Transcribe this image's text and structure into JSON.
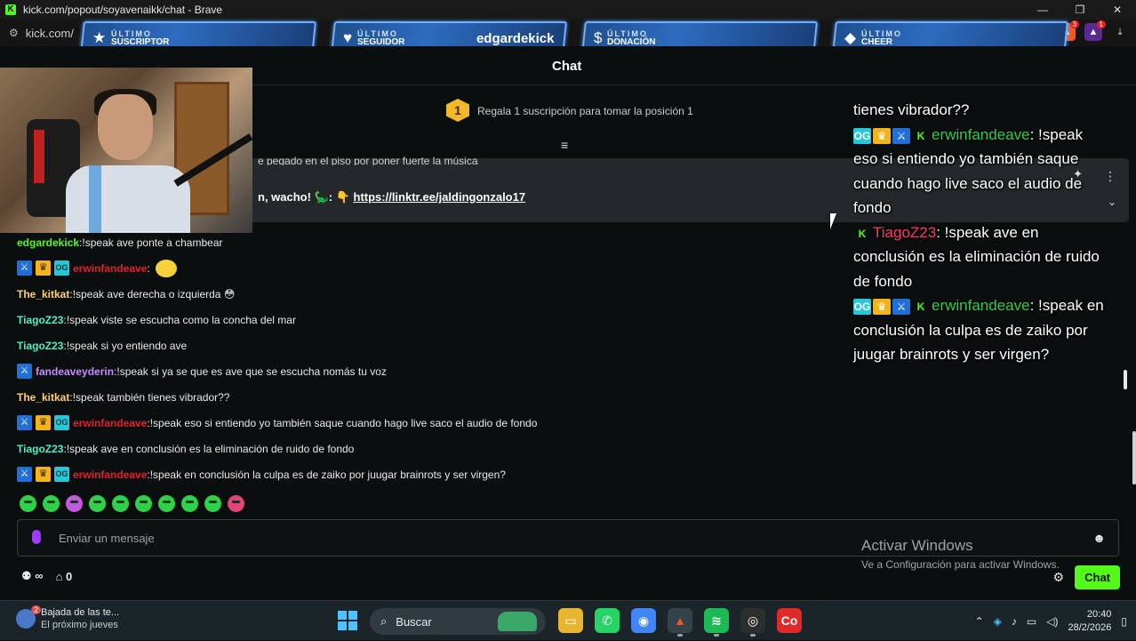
{
  "window": {
    "title": "kick.com/popout/soyavenaikk/chat - Brave",
    "url": "kick.com/",
    "controls": [
      "—",
      "❐",
      "✕"
    ]
  },
  "extensions": {
    "brave_count": "3",
    "rewards_count": "1"
  },
  "alerts": [
    {
      "label_top": "ÚLTIMO",
      "label_bottom": "SUSCRIPTOR",
      "icon": "star-icon",
      "glyph": "★",
      "name": ""
    },
    {
      "label_top": "ÚLTIMO",
      "label_bottom": "SEGUIDOR",
      "icon": "heart-icon",
      "glyph": "♥",
      "name": "edgardekick"
    },
    {
      "label_top": "ÚLTIMO",
      "label_bottom": "DONACIÓN",
      "icon": "dollar-icon",
      "glyph": "$",
      "name": ""
    },
    {
      "label_top": "ÚLTIMO",
      "label_bottom": "CHEER",
      "icon": "diamond-icon",
      "glyph": "◆",
      "name": ""
    }
  ],
  "chat_header": {
    "title": "Chat"
  },
  "gift_bar": {
    "position": "1",
    "text": "Regala 1 suscripción para tomar la posición 1"
  },
  "pinned": {
    "top_text": "e pegado en el piso por poner fuerte la música",
    "prefix": "n, wacho! 🦕: 👇",
    "link": "https://linktr.ee/jaldingonzalo17"
  },
  "messages": [
    {
      "badges": [],
      "user": "edgardekick",
      "color": "u-green",
      "text": "!speak ave ponte a chambear"
    },
    {
      "badges": [
        "sword",
        "crown",
        "og"
      ],
      "user": "erwinfandeave",
      "color": "u-red",
      "text": "",
      "emote": true
    },
    {
      "badges": [],
      "user": "The_kitkat",
      "color": "u-yellow",
      "text": "!speak ave derecha o izquierda 😳"
    },
    {
      "badges": [],
      "user": "TiagoZ23",
      "color": "u-teal",
      "text": "!speak viste se escucha como la concha del mar"
    },
    {
      "badges": [],
      "user": "TiagoZ23",
      "color": "u-teal",
      "text": "!speak si yo entiendo ave"
    },
    {
      "badges": [
        "sword"
      ],
      "user": "fandeaveyderin",
      "color": "u-purple",
      "text": "!speak si ya se que es ave que se escucha nomás tu voz"
    },
    {
      "badges": [],
      "user": "The_kitkat",
      "color": "u-yellow",
      "text": "!speak también tienes vibrador??"
    },
    {
      "badges": [
        "sword",
        "crown",
        "og"
      ],
      "user": "erwinfandeave",
      "color": "u-red",
      "text": "!speak eso si entiendo yo también saque cuando hago live saco el audio de fondo"
    },
    {
      "badges": [],
      "user": "TiagoZ23",
      "color": "u-teal",
      "text": "!speak ave en conclusión es la eliminación de ruido de fondo"
    },
    {
      "badges": [
        "sword",
        "crown",
        "og"
      ],
      "user": "erwinfandeave",
      "color": "u-red",
      "text": "!speak en conclusión la culpa es de zaiko por juugar brainrots y ser virgen?"
    }
  ],
  "tts_overlay": {
    "line0": "tienes vibrador??",
    "entries": [
      {
        "user": "erwinfandeave",
        "color": "#2fd14a",
        "text": "!speak eso si entiendo yo también saque cuando hago live saco el audio de fondo",
        "badges": true
      },
      {
        "user": "TiagoZ23",
        "color": "#ff3a6a",
        "text": "!speak ave en conclusión es la eliminación de ruido de fondo",
        "badges": false
      },
      {
        "user": "erwinfandeave",
        "color": "#2fd14a",
        "text": "!speak en conclusión la culpa es de zaiko por juugar brainrots y ser virgen?",
        "badges": true
      }
    ]
  },
  "input": {
    "placeholder": "Enviar un mensaje"
  },
  "footer": {
    "points": "∞",
    "store_count": "0",
    "chat_button": "Chat"
  },
  "watermark": {
    "line1": "Activar Windows",
    "line2": "Ve a Configuración para activar Windows."
  },
  "taskbar": {
    "weather_badge": "2",
    "weather_title": "Bajada de las te...",
    "weather_sub": "El próximo jueves",
    "search": "Buscar",
    "time": "20:40",
    "date": "28/2/2026"
  }
}
